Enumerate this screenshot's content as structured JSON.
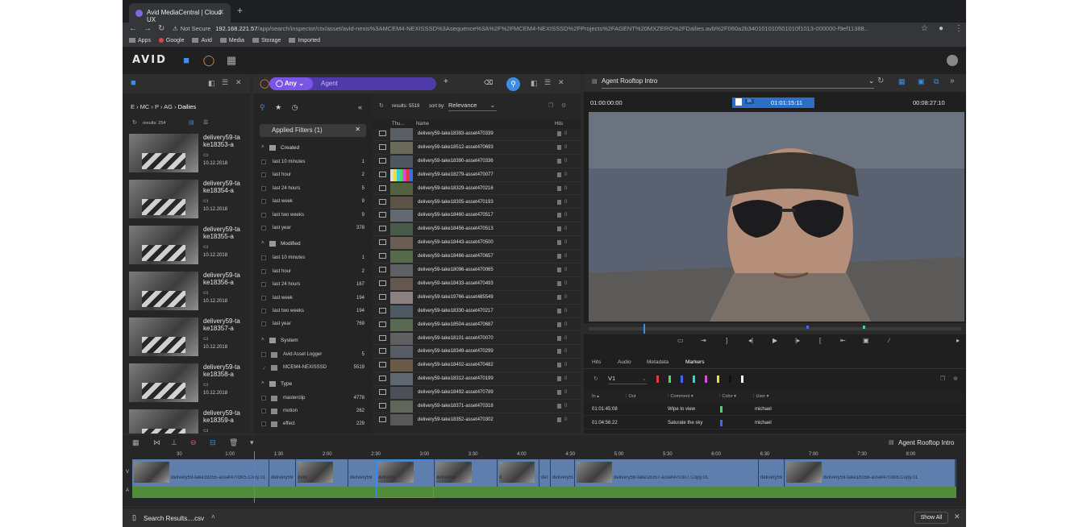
{
  "browser": {
    "tab_title": "Avid MediaCentral | Cloud UX",
    "not_secure": "Not Secure",
    "url_host": "192.168.221.57",
    "url_path": "/app/search/inspector/ctx/asset/avid-nexis%3AMCEM4-NEXISSSD%3Asequence%3A%2F%2FMCEM4-NEXISSSD%2FProjects%2FAGENT%20MXZERO%2FDailies.avb%2F060a2b340101010501010f1013-000000-f9ef11388...",
    "bookmarks": [
      "Apps",
      "Google",
      "Avid",
      "Media",
      "Storage",
      "Imported"
    ]
  },
  "app": {
    "logo": "AVID"
  },
  "browse": {
    "breadcrumb": [
      "MC",
      "P",
      "AG",
      "Dailies"
    ],
    "results": "results: 254",
    "items": [
      {
        "name": "delivery59-take18353-a",
        "date": "10.12.2018"
      },
      {
        "name": "delivery59-take18354-a",
        "date": "10.12.2018"
      },
      {
        "name": "delivery59-take18355-a",
        "date": "10.12.2018"
      },
      {
        "name": "delivery59-take18356-a",
        "date": "10.12.2018"
      },
      {
        "name": "delivery59-take18357-a",
        "date": "10.12.2018"
      },
      {
        "name": "delivery59-take18358-a",
        "date": "10.12.2018"
      },
      {
        "name": "delivery59-take18359-a",
        "date": ""
      }
    ]
  },
  "search": {
    "scope": "Any",
    "query": "Agent",
    "applied_filters": "Applied Filters (1)",
    "sections": [
      {
        "title": "Created",
        "rows": [
          {
            "label": "last 10 minutes",
            "count": "1"
          },
          {
            "label": "last hour",
            "count": "2"
          },
          {
            "label": "last 24 hours",
            "count": "5"
          },
          {
            "label": "last week",
            "count": "9"
          },
          {
            "label": "last two weeks",
            "count": "9"
          },
          {
            "label": "last year",
            "count": "378"
          }
        ]
      },
      {
        "title": "Modified",
        "rows": [
          {
            "label": "last 10 minutes",
            "count": "1"
          },
          {
            "label": "last hour",
            "count": "2"
          },
          {
            "label": "last 24 hours",
            "count": "167"
          },
          {
            "label": "last week",
            "count": "194"
          },
          {
            "label": "last two weeks",
            "count": "194"
          },
          {
            "label": "last year",
            "count": "769"
          }
        ]
      },
      {
        "title": "System",
        "rows": [
          {
            "label": "Avid Asset Logger",
            "count": "5"
          },
          {
            "label": "MCEM4-NEXISSSD",
            "count": "5519"
          }
        ]
      },
      {
        "title": "Type",
        "rows": [
          {
            "label": "masterclip",
            "count": "4778"
          },
          {
            "label": "motion",
            "count": "262"
          },
          {
            "label": "effect",
            "count": "229"
          }
        ]
      }
    ]
  },
  "results": {
    "count": "results: 5519",
    "sort_label": "sort by:",
    "sort_value": "Relevance",
    "col_thumb": "Thu...",
    "col_name": "Name",
    "col_hits": "Hits",
    "hit_value": "0",
    "rows": [
      "delivery59-take18393-asset470339",
      "delivery59-take18512-asset470693",
      "delivery59-take18390-asset470336",
      "delivery59-take18279-asset470077",
      "delivery59-take18329-asset470216",
      "delivery59-take18305-asset470193",
      "delivery59-take18460-asset470517",
      "delivery59-take18456-asset470513",
      "delivery59-take18443-asset470500",
      "delivery59-take18466-asset470657",
      "delivery59-take18096-asset470065",
      "delivery59-take18433-asset470493",
      "delivery59-take19766-asset485549",
      "delivery59-take18330-asset470217",
      "delivery59-take18504-asset470687",
      "delivery59-take18101-asset470070",
      "delivery59-take18349-asset470299",
      "delivery59-take18402-asset470482",
      "delivery59-take18312-asset470199",
      "delivery59-take18492-asset470789",
      "delivery59-take18371-asset470318",
      "delivery59-take18352-asset470302"
    ]
  },
  "player": {
    "title": "Agent Rooftop Intro",
    "tc_start": "01:00:00:00",
    "tc_mode": "in",
    "tc_current": "01:01:15:11",
    "tc_duration": "00:08:27:10",
    "tabs": [
      "Hits",
      "Audio",
      "Metadata",
      "Markers"
    ],
    "track": "V1",
    "marker_cols": [
      "In",
      "Out",
      "Comment",
      "Color",
      "User"
    ],
    "markers": [
      {
        "in": "01:01:45:08",
        "out": "",
        "comment": "Wipe to view",
        "color": "#4cd964",
        "user": "michael"
      },
      {
        "in": "01:04:56:22",
        "out": "",
        "comment": "Saturate the sky",
        "color": "#3a6ee8",
        "user": "michael"
      }
    ],
    "swatches": [
      "#e23b3b",
      "#4cd964",
      "#3a6ee8",
      "#38d0e0",
      "#d94ce0",
      "#e8e03a",
      "#111111",
      "#ffffff"
    ]
  },
  "timeline": {
    "sequence_title": "Agent Rooftop Intro",
    "ticks": [
      "30",
      "1:00",
      "1:30",
      "2:00",
      "2:30",
      "3:00",
      "3:30",
      "4:00",
      "4:30",
      "5:00",
      "5:30",
      "6:00",
      "6:30",
      "7:00",
      "7:30",
      "8:00"
    ],
    "track_v": "V",
    "track_a": "A",
    "clips": [
      {
        "label": "delivery59-take18355-asset470305.Copy.01"
      },
      {
        "label": "delivery59"
      },
      {
        "label": "deliv"
      },
      {
        "label": "delivery59"
      },
      {
        "label": "delivery"
      },
      {
        "label": "delivery5"
      },
      {
        "label": "d"
      },
      {
        "label": "del"
      },
      {
        "label": "delivery59"
      },
      {
        "label": "delivery59-take18357-asset470307.Copy.01"
      },
      {
        "label": "delivery59"
      },
      {
        "label": "delivery59-take18358-asset470308.Copy.01"
      }
    ]
  },
  "download": {
    "file": "Search Results....csv",
    "show_all": "Show All"
  }
}
